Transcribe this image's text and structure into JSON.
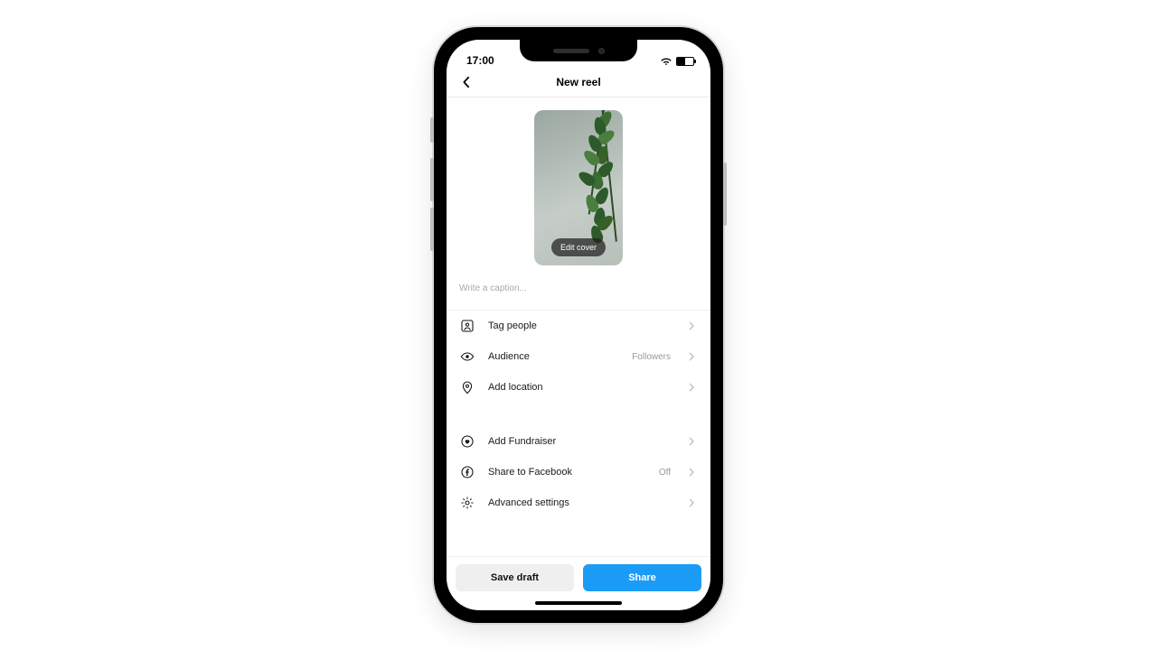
{
  "statusbar": {
    "time": "17:00"
  },
  "header": {
    "title": "New reel"
  },
  "cover": {
    "edit_label": "Edit cover"
  },
  "caption": {
    "placeholder": "Write a caption..."
  },
  "rows": {
    "tag_people": {
      "label": "Tag people"
    },
    "audience": {
      "label": "Audience",
      "value": "Followers"
    },
    "location": {
      "label": "Add location"
    },
    "fundraiser": {
      "label": "Add Fundraiser"
    },
    "facebook": {
      "label": "Share to Facebook",
      "value": "Off"
    },
    "advanced": {
      "label": "Advanced settings"
    }
  },
  "footer": {
    "save_draft": "Save draft",
    "share": "Share"
  }
}
